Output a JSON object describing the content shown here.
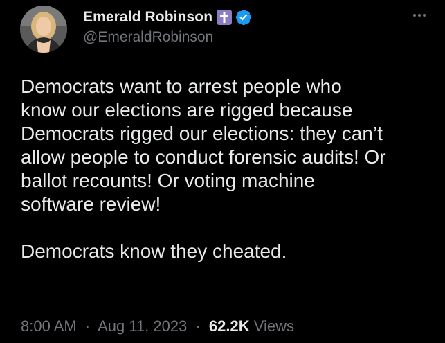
{
  "author": {
    "display_name": "Emerald Robinson",
    "handle": "@EmeraldRobinson",
    "badges": [
      "cross-icon",
      "verified-icon"
    ]
  },
  "colors": {
    "background": "#000000",
    "text": "#e7e9ea",
    "secondary": "#71767b",
    "verified": "#1d9bf0",
    "cross_badge": "#8e7cc3"
  },
  "tweet": {
    "paragraph_1": "Democrats want to arrest people who\nknow our elections are rigged because\nDemocrats rigged our elections: they can’t\nallow people to conduct forensic audits! Or\nballot recounts! Or voting machine\nsoftware review!",
    "paragraph_2": "Democrats know they cheated."
  },
  "meta": {
    "time": "8:00 AM",
    "date": "Aug 11, 2023",
    "separator": "·",
    "views_count": "62.2K",
    "views_label": "Views"
  }
}
